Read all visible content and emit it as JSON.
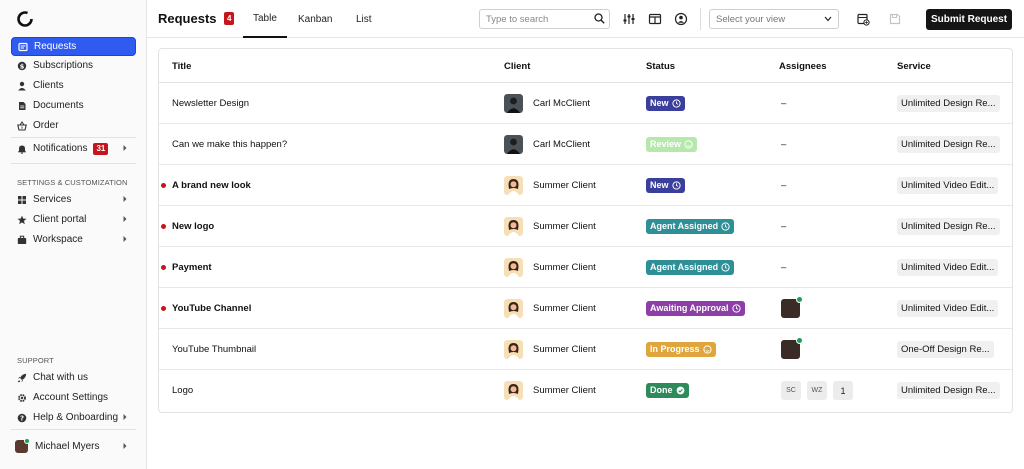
{
  "sidebar": {
    "items": [
      {
        "label": "Requests",
        "icon": "inbox-icon"
      },
      {
        "label": "Subscriptions",
        "icon": "dollar-icon"
      },
      {
        "label": "Clients",
        "icon": "user-icon"
      },
      {
        "label": "Documents",
        "icon": "document-icon"
      },
      {
        "label": "Order",
        "icon": "basket-icon"
      }
    ],
    "notifications": {
      "label": "Notifications",
      "count": "31",
      "icon": "bell-icon"
    },
    "settings_label": "SETTINGS & CUSTOMIZATION",
    "settings_items": [
      {
        "label": "Services",
        "icon": "grid-icon"
      },
      {
        "label": "Client portal",
        "icon": "star-icon"
      },
      {
        "label": "Workspace",
        "icon": "briefcase-icon"
      }
    ],
    "support_label": "SUPPORT",
    "support_items": [
      {
        "label": "Chat with us",
        "icon": "rocket-icon"
      },
      {
        "label": "Account Settings",
        "icon": "gear-icon"
      },
      {
        "label": "Help & Onboarding",
        "icon": "question-icon"
      }
    ],
    "user": {
      "name": "Michael Myers"
    }
  },
  "header": {
    "title": "Requests",
    "count": "4",
    "tabs": [
      "Table",
      "Kanban",
      "List"
    ],
    "search_placeholder": "Type to search",
    "view_placeholder": "Select your view",
    "submit_label": "Submit Request"
  },
  "table": {
    "columns": [
      "Title",
      "Client",
      "Status",
      "Assignees",
      "Service"
    ],
    "rows": [
      {
        "title": "Newsletter Design",
        "unread": false,
        "client": "Carl McClient",
        "client_avatar": "dark",
        "status": "New",
        "status_color": "#3b3f9c",
        "status_icon": "clock",
        "assignees": "–",
        "service": "Unlimited Design Re..."
      },
      {
        "title": "Can we make this happen?",
        "unread": false,
        "client": "Carl McClient",
        "client_avatar": "dark",
        "status": "Review",
        "status_color": "#b6e7ad",
        "status_icon": "smile",
        "assignees": "–",
        "service": "Unlimited Design Re..."
      },
      {
        "title": "A brand new look",
        "unread": true,
        "client": "Summer Client",
        "client_avatar": "light",
        "status": "New",
        "status_color": "#3b3f9c",
        "status_icon": "clock",
        "assignees": "–",
        "service": "Unlimited Video Edit..."
      },
      {
        "title": "New logo",
        "unread": true,
        "client": "Summer Client",
        "client_avatar": "light",
        "status": "Agent Assigned",
        "status_color": "#2f8f96",
        "status_icon": "clock",
        "assignees": "–",
        "service": "Unlimited Design Re..."
      },
      {
        "title": "Payment",
        "unread": true,
        "client": "Summer Client",
        "client_avatar": "light",
        "status": "Agent Assigned",
        "status_color": "#2f8f96",
        "status_icon": "clock",
        "assignees": "–",
        "service": "Unlimited Video Edit..."
      },
      {
        "title": "YouTube Channel",
        "unread": true,
        "client": "Summer Client",
        "client_avatar": "light",
        "status": "Awaiting Approval",
        "status_color": "#8d3fa8",
        "status_icon": "clock",
        "assignees": "avatar",
        "service": "Unlimited Video Edit..."
      },
      {
        "title": "YouTube Thumbnail",
        "unread": false,
        "client": "Summer Client",
        "client_avatar": "light",
        "status": "In Progress",
        "status_color": "#e0a53c",
        "status_icon": "smile",
        "assignees": "avatar",
        "service": "One-Off Design Re..."
      },
      {
        "title": "Logo",
        "unread": false,
        "client": "Summer Client",
        "client_avatar": "light",
        "status": "Done",
        "status_color": "#2e8a5a",
        "status_icon": "check",
        "assignees": "initials",
        "assignee_initials": [
          "SC",
          "WZ"
        ],
        "assignee_extra": "1",
        "service": "Unlimited Design Re..."
      }
    ]
  }
}
